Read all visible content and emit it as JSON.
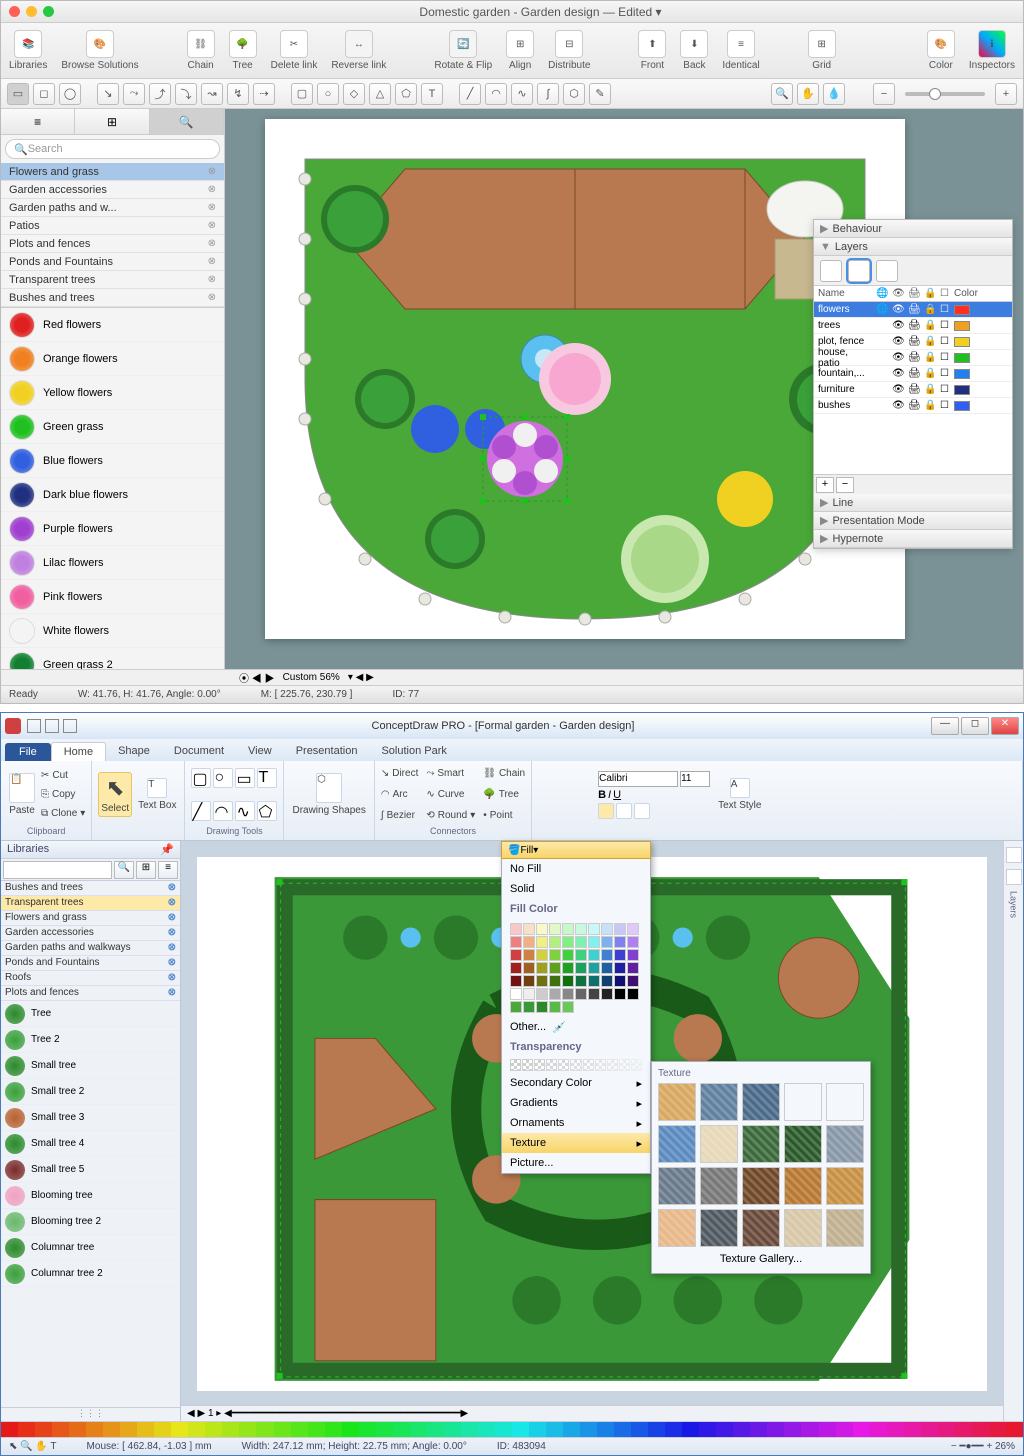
{
  "mac": {
    "title": "Domestic garden - Garden design — Edited ▾",
    "toolbar": [
      {
        "label": "Libraries"
      },
      {
        "label": "Browse Solutions"
      },
      {
        "label": "Chain"
      },
      {
        "label": "Tree"
      },
      {
        "label": "Delete link"
      },
      {
        "label": "Reverse link"
      },
      {
        "label": "Rotate & Flip"
      },
      {
        "label": "Align"
      },
      {
        "label": "Distribute"
      },
      {
        "label": "Front"
      },
      {
        "label": "Back"
      },
      {
        "label": "Identical"
      },
      {
        "label": "Grid"
      },
      {
        "label": "Color"
      },
      {
        "label": "Inspectors"
      }
    ],
    "search_placeholder": "Search",
    "categories": [
      {
        "name": "Flowers and grass",
        "sel": true
      },
      {
        "name": "Garden accessories"
      },
      {
        "name": "Garden paths and w..."
      },
      {
        "name": "Patios"
      },
      {
        "name": "Plots and fences"
      },
      {
        "name": "Ponds and Fountains"
      },
      {
        "name": "Transparent trees"
      },
      {
        "name": "Bushes and trees"
      }
    ],
    "shapes": [
      {
        "name": "Red flowers",
        "color": "#e02020"
      },
      {
        "name": "Orange flowers",
        "color": "#f08020"
      },
      {
        "name": "Yellow flowers",
        "color": "#f0d020"
      },
      {
        "name": "Green grass",
        "color": "#20c020"
      },
      {
        "name": "Blue flowers",
        "color": "#3060e0"
      },
      {
        "name": "Dark blue flowers",
        "color": "#203080"
      },
      {
        "name": "Purple flowers",
        "color": "#a040d0"
      },
      {
        "name": "Lilac flowers",
        "color": "#c080e0"
      },
      {
        "name": "Pink flowers",
        "color": "#f060a0"
      },
      {
        "name": "White flowers",
        "color": "#f4f4f4"
      },
      {
        "name": "Green grass 2",
        "color": "#108030"
      }
    ],
    "panel": {
      "behaviour": "Behaviour",
      "layers_title": "Layers",
      "line": "Line",
      "presentation": "Presentation Mode",
      "hypernote": "Hypernote",
      "head": {
        "name": "Name",
        "color": "Color"
      },
      "layers": [
        {
          "name": "flowers",
          "color": "#ff3020",
          "sel": true
        },
        {
          "name": "trees",
          "color": "#f0a020"
        },
        {
          "name": "plot, fence",
          "color": "#f0d020"
        },
        {
          "name": "house, patio",
          "color": "#20c020"
        },
        {
          "name": "fountain,...",
          "color": "#2080f0"
        },
        {
          "name": "furniture",
          "color": "#203080"
        },
        {
          "name": "bushes",
          "color": "#3060f0"
        }
      ]
    },
    "ruler": {
      "zoom": "Custom 56%"
    },
    "status": {
      "ready": "Ready",
      "wh": "W: 41.76,  H: 41.76,  Angle: 0.00°",
      "m": "M: [ 225.76, 230.79 ]",
      "id": "ID: 77"
    }
  },
  "win": {
    "title": "ConceptDraw PRO - [Formal garden - Garden design]",
    "tabs": {
      "file": "File",
      "items": [
        "Home",
        "Shape",
        "Document",
        "View",
        "Presentation",
        "Solution Park"
      ]
    },
    "ribbon": {
      "clipboard": {
        "paste": "Paste",
        "cut": "Cut",
        "copy": "Copy",
        "clone": "Clone",
        "label": "Clipboard"
      },
      "select": "Select",
      "textbox": "Text Box",
      "drawing": {
        "label": "Drawing Tools"
      },
      "shapes": {
        "label": "Drawing Shapes"
      },
      "connectors": {
        "direct": "Direct",
        "arc": "Arc",
        "bezier": "Bezier",
        "smart": "Smart",
        "curve": "Curve",
        "round": "Round",
        "chain": "Chain",
        "tree": "Tree",
        "point": "Point",
        "label": "Connectors"
      },
      "font": {
        "name": "Calibri",
        "size": "11"
      },
      "textstyle": "Text Style"
    },
    "sidebar": {
      "title": "Libraries",
      "categories": [
        {
          "name": "Bushes and trees"
        },
        {
          "name": "Transparent trees",
          "sel": true
        },
        {
          "name": "Flowers and grass"
        },
        {
          "name": "Garden accessories"
        },
        {
          "name": "Garden paths and walkways"
        },
        {
          "name": "Ponds and Fountains"
        },
        {
          "name": "Roofs"
        },
        {
          "name": "Plots and fences"
        }
      ],
      "shapes": [
        {
          "name": "Tree",
          "c": "#2a8a2a"
        },
        {
          "name": "Tree 2",
          "c": "#3aa03a"
        },
        {
          "name": "Small tree",
          "c": "#2a8a2a"
        },
        {
          "name": "Small tree 2",
          "c": "#3aa03a"
        },
        {
          "name": "Small tree 3",
          "c": "#b86030"
        },
        {
          "name": "Small tree 4",
          "c": "#2a8a2a"
        },
        {
          "name": "Small tree 5",
          "c": "#7a2a2a"
        },
        {
          "name": "Blooming tree",
          "c": "#f0a0c0"
        },
        {
          "name": "Blooming tree 2",
          "c": "#6ab86a"
        },
        {
          "name": "Columnar tree",
          "c": "#2a8a2a"
        },
        {
          "name": "Columnar tree 2",
          "c": "#3aa03a"
        }
      ]
    },
    "fill": {
      "btn": "Fill",
      "nofill": "No Fill",
      "solid": "Solid",
      "fillcolor": "Fill Color",
      "other": "Other...",
      "transparency": "Transparency",
      "secondary": "Secondary Color",
      "gradients": "Gradients",
      "ornaments": "Ornaments",
      "texture": "Texture",
      "picture": "Picture..."
    },
    "texture": {
      "title": "Texture",
      "gallery": "Texture Gallery..."
    },
    "right_rail": "Layers",
    "status": {
      "mouse": "Mouse: [ 462.84, -1.03 ] mm",
      "size": "Width: 247.12 mm;  Height: 22.75 mm;  Angle: 0.00°",
      "id": "ID: 483094",
      "zoom": "26%"
    }
  }
}
